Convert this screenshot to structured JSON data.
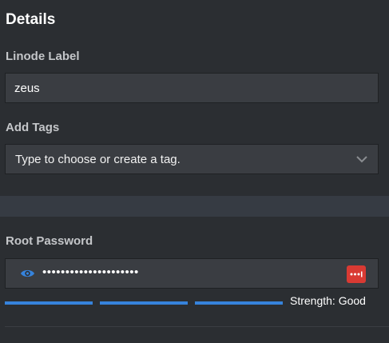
{
  "details": {
    "title": "Details",
    "label_caption": "Linode Label",
    "label_value": "zeus",
    "tags_caption": "Add Tags",
    "tags_placeholder": "Type to choose or create a tag."
  },
  "password": {
    "caption": "Root Password",
    "masked_value": "•••••••••••••••••••••",
    "strength_text": "Strength: Good",
    "strength_level": 1.0
  },
  "colors": {
    "accent": "#3683dc",
    "password_manager": "#d93a33",
    "background": "#2b2e32",
    "field": "#3a3d42"
  },
  "icons": [
    "eye-icon",
    "chevron-down-icon",
    "password-manager-icon"
  ]
}
